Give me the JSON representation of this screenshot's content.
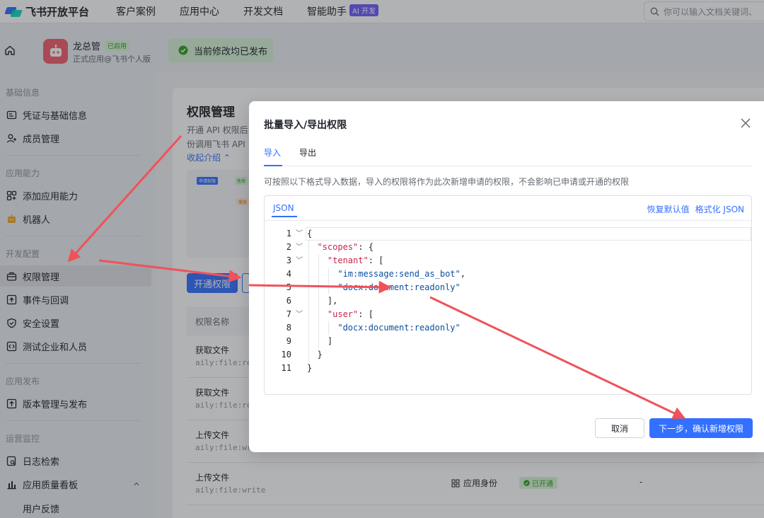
{
  "topnav": {
    "brand": "飞书开放平台",
    "links": [
      "客户案例",
      "应用中心",
      "开发文档",
      "智能助手"
    ],
    "ai_badge": "AI 开发",
    "search_placeholder": "你可以输入文档关键词、"
  },
  "app": {
    "name": "龙总管",
    "status": "已启用",
    "subtitle": "正式应用@飞书个人版",
    "publish_status": "当前修改均已发布"
  },
  "sidebar": {
    "sections": [
      {
        "title": "基础信息",
        "items": [
          "凭证与基础信息",
          "成员管理"
        ]
      },
      {
        "title": "应用能力",
        "items": [
          "添加应用能力",
          "机器人"
        ]
      },
      {
        "title": "开发配置",
        "items": [
          "权限管理",
          "事件与回调",
          "安全设置",
          "测试企业和人员"
        ]
      },
      {
        "title": "应用发布",
        "items": [
          "版本管理与发布"
        ]
      },
      {
        "title": "运营监控",
        "items": [
          "日志检索",
          "应用质量看板",
          "用户反馈"
        ]
      }
    ]
  },
  "main": {
    "title": "权限管理",
    "desc_line1": "开通 API 权限后",
    "desc_line2": "份调用飞书 API",
    "collapse_link": "收起介绍",
    "diagram_tags": [
      "申请权限",
      "免审",
      "需审"
    ],
    "open_button": "开通权限",
    "table_header": "权限名称",
    "rows": [
      {
        "name": "获取文件",
        "code": "aily:file:read"
      },
      {
        "name": "获取文件",
        "code": "aily:file:read"
      },
      {
        "name": "上传文件",
        "code": "aily:file:write"
      },
      {
        "name": "上传文件",
        "code": "aily:file:write",
        "identity": "应用身份",
        "status": "已开通",
        "dash": "-"
      }
    ]
  },
  "modal": {
    "title": "批量导入/导出权限",
    "tabs": [
      "导入",
      "导出"
    ],
    "description": "可按照以下格式导入数据，导入的权限将作为此次新增申请的权限，不会影响已申请或开通的权限",
    "editor_tab": "JSON",
    "editor_actions": [
      "恢复默认值",
      "格式化 JSON"
    ],
    "code_lines": [
      {
        "n": "1",
        "fold": true
      },
      {
        "n": "2",
        "fold": true
      },
      {
        "n": "3",
        "fold": true
      },
      {
        "n": "4",
        "fold": false
      },
      {
        "n": "5",
        "fold": false
      },
      {
        "n": "6",
        "fold": false
      },
      {
        "n": "7",
        "fold": true
      },
      {
        "n": "8",
        "fold": false
      },
      {
        "n": "9",
        "fold": false
      },
      {
        "n": "10",
        "fold": false
      },
      {
        "n": "11",
        "fold": false
      }
    ],
    "json": {
      "open_brace": "{",
      "scopes_key": "\"scopes\"",
      "tenant_key": "\"tenant\"",
      "tenant_scope_1": "\"im:message:send_as_bot\"",
      "tenant_scope_2": "\"docx:document:readonly\"",
      "user_key": "\"user\"",
      "user_scope_1": "\"docx:document:readonly\"",
      "close_brace": "}"
    },
    "cancel": "取消",
    "confirm": "下一步，确认新增权限"
  },
  "colors": {
    "accent": "#3370ff",
    "arrow": "#f0525a",
    "success": "#2ea121"
  }
}
